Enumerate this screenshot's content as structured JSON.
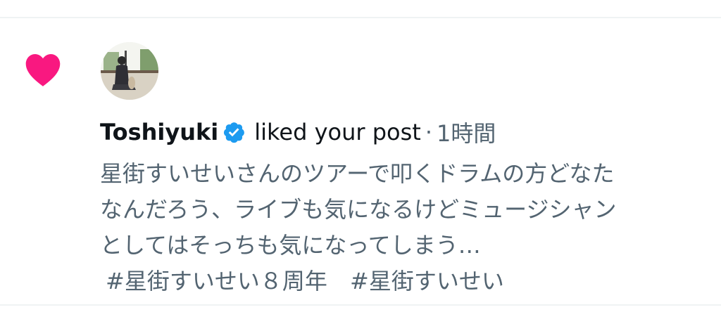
{
  "notification": {
    "type_icon": "heart-icon",
    "colors": {
      "like_pink": "#f91880",
      "verified_blue": "#1d9bf0",
      "primary_text": "#0f1419",
      "secondary_text": "#536471",
      "divider": "#eff3f4"
    },
    "user": {
      "name": "Toshiyuki",
      "verified": true,
      "avatar_icon": "avatar-photo"
    },
    "action": "liked your post",
    "separator": "·",
    "time": "1時間",
    "post": {
      "lines": [
        "星街すいせいさんのツアーで叩くドラムの方どなた",
        "なんだろう、ライブも気になるけどミュージシャン",
        "としてはそっちも気になってしまう…"
      ],
      "hashtags": [
        "#星街すいせい８周年",
        "#星街すいせい"
      ]
    }
  }
}
